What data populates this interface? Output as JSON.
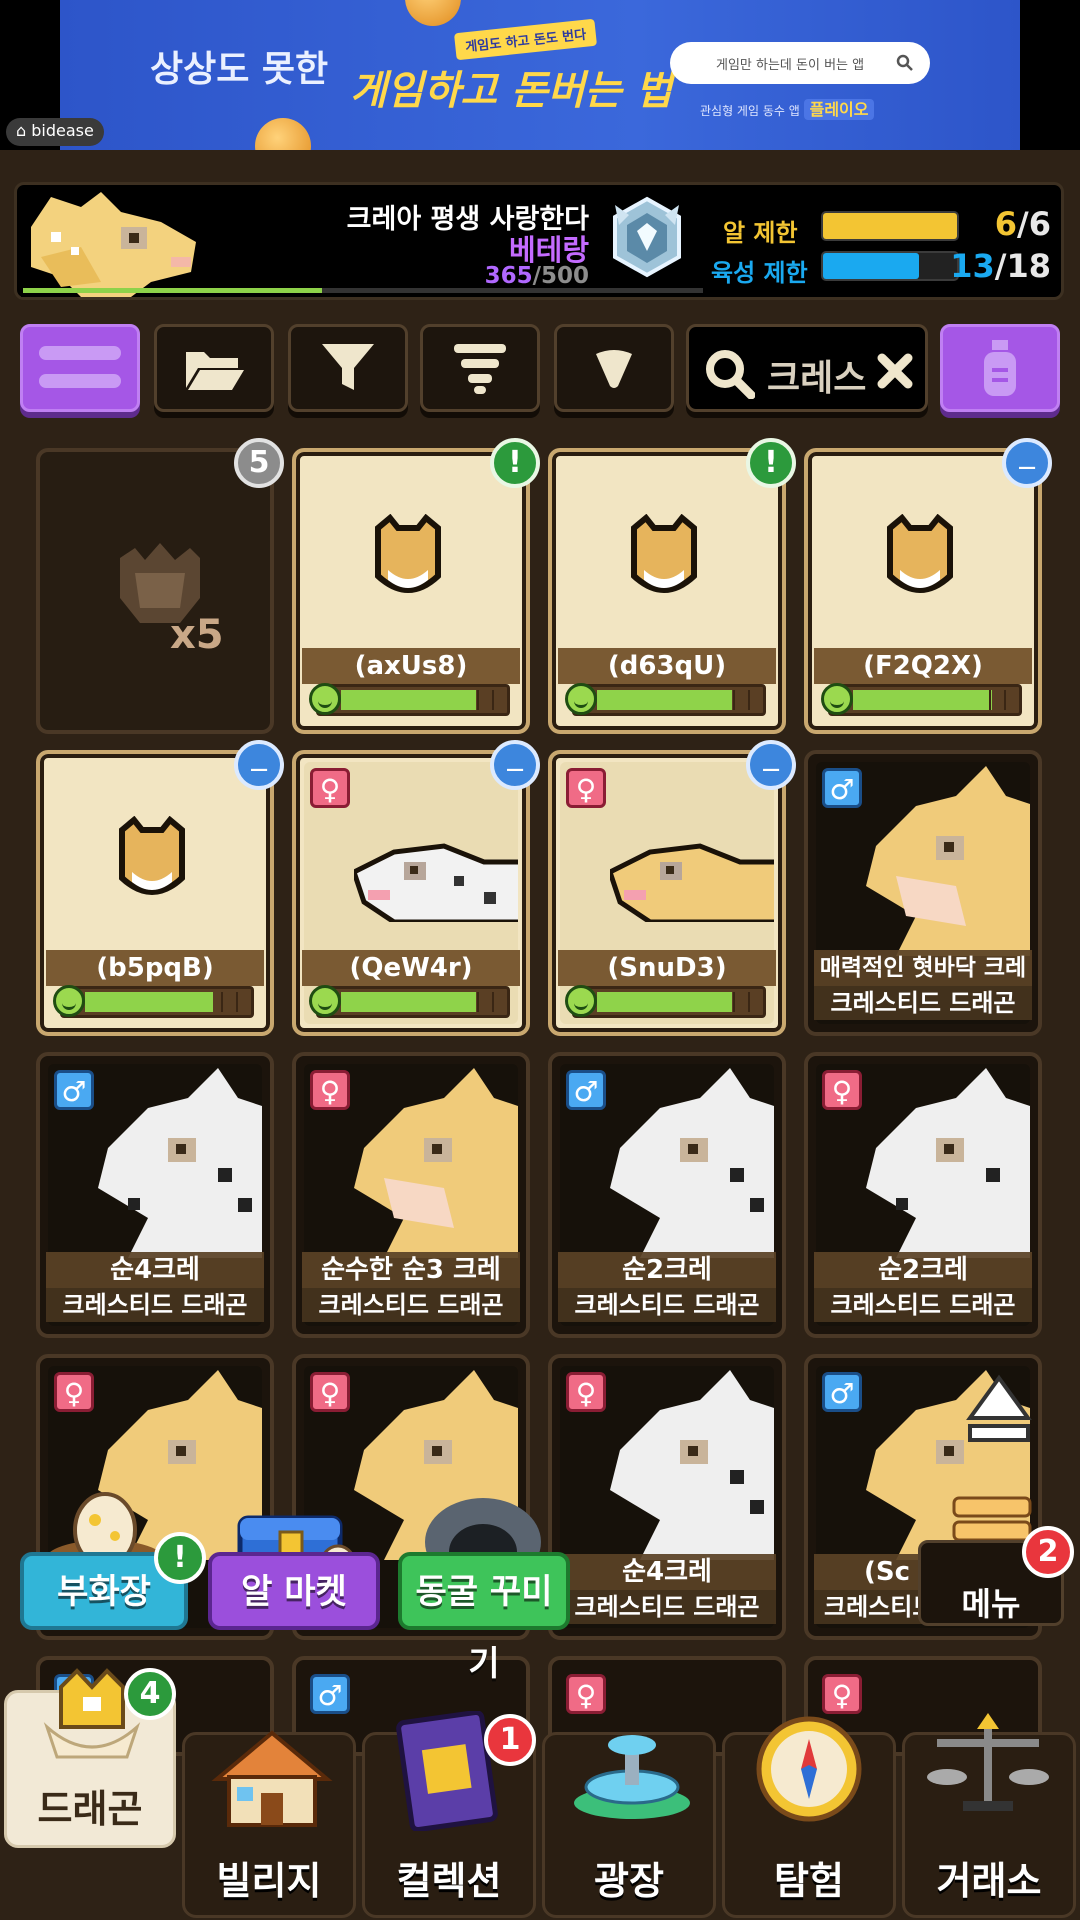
{
  "ad": {
    "headline_1": "상상도 못한",
    "headline_2": "게임하고 돈버는 법",
    "tag": "게임도 하고 돈도 번다",
    "search_placeholder": "게임만 하는데 돈이 버는 앱",
    "sub_text": "관심형 게임 동수 앱",
    "brand": "플레이오",
    "provider": "bidease"
  },
  "profile": {
    "name": "크레아 평생 사랑한다",
    "title": "베테랑",
    "exp_current": "365",
    "exp_max": "/500",
    "exp_fraction": 0.44,
    "egg_limit_label": "알 제한",
    "egg_limit_value": "6",
    "egg_limit_max": "/6",
    "egg_limit_fraction": 1.0,
    "breed_limit_label": "육성 제한",
    "breed_limit_value": "13",
    "breed_limit_max": "/18",
    "breed_limit_fraction": 0.72
  },
  "toolbar": {
    "search_value": "크레스"
  },
  "cards": {
    "egg_count": "x5",
    "egg_badge": "5",
    "c2_name": "(axUs8)",
    "c3_name": "(d63qU)",
    "c4_name": "(F2Q2X)",
    "c5_name": "(b5pqB)",
    "c6_name": "(QeW4r)",
    "c7_name": "(SnuD3)",
    "c8_name": "매력적인 혓바닥 크레",
    "c9_name": "순4크레",
    "c10_name": "순수한 순3 크레",
    "c11_name": "순2크레",
    "c12_name": "순2크레",
    "c15_name": "순4크레",
    "c16_name": "(Sc",
    "species": "크레스티드 드래곤",
    "excl": "!",
    "male": "♂",
    "female": "♀"
  },
  "shortcuts": {
    "incubator": "부화장",
    "egg_market": "알 마켓",
    "cave_deco": "동굴 꾸미기",
    "menu": "메뉴",
    "menu_badge": "2"
  },
  "nav": {
    "dragon": "드래곤",
    "dragon_badge": "4",
    "village": "빌리지",
    "collection": "컬렉션",
    "collection_badge": "1",
    "plaza": "광장",
    "explore": "탐험",
    "exchange": "거래소"
  },
  "colors": {
    "purple": "#a557e6",
    "egg_bar": "#f3c533",
    "breed_bar": "#1aa9f0",
    "health_green": "#8fd34a"
  }
}
